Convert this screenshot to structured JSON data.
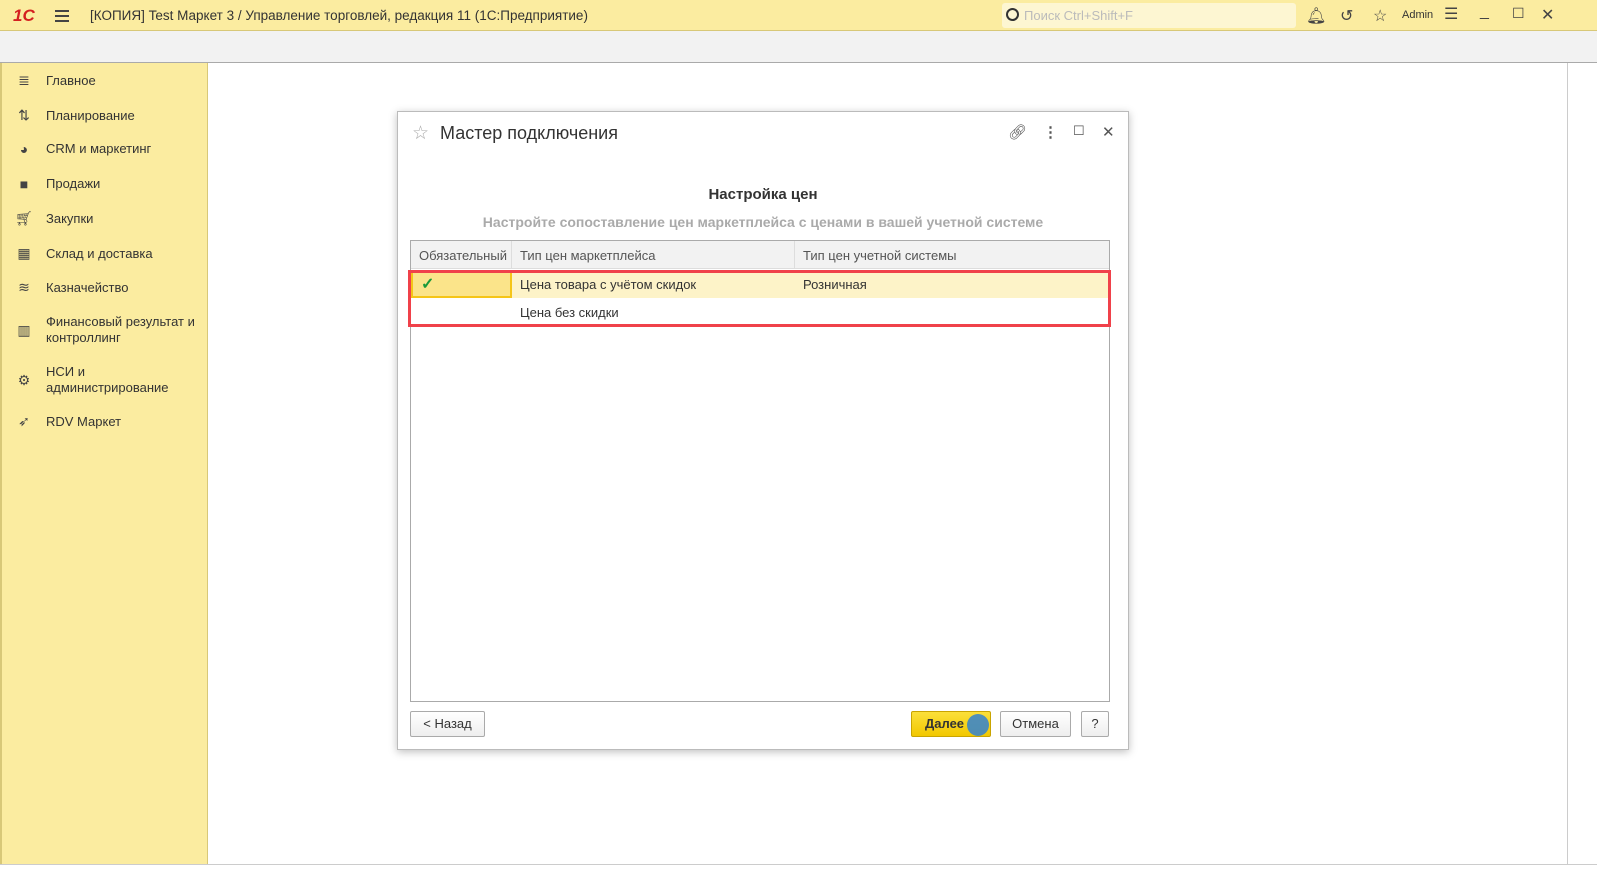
{
  "app": {
    "logo": "1С",
    "title": "[КОПИЯ] Test Маркет 3 / Управление торговлей, редакция 11  (1С:Предприятие)",
    "search_placeholder": "Поиск Ctrl+Shift+F",
    "user": "Admin"
  },
  "sidebar": {
    "items": [
      {
        "label": "Главное",
        "icon": "list-icon"
      },
      {
        "label": "Планирование",
        "icon": "planning-icon"
      },
      {
        "label": "CRM и маркетинг",
        "icon": "pie-chart-icon"
      },
      {
        "label": "Продажи",
        "icon": "bag-icon"
      },
      {
        "label": "Закупки",
        "icon": "cart-icon"
      },
      {
        "label": "Склад и доставка",
        "icon": "warehouse-icon"
      },
      {
        "label": "Казначейство",
        "icon": "coins-icon"
      },
      {
        "label": "Финансовый результат и контроллинг",
        "icon": "bar-chart-icon"
      },
      {
        "label": "НСИ и администрирование",
        "icon": "gear-icon"
      },
      {
        "label": "RDV Маркет",
        "icon": "rocket-icon"
      }
    ]
  },
  "dialog": {
    "title": "Мастер подключения",
    "heading": "Настройка цен",
    "subheading": "Настройте сопоставление цен маркетплейса с ценами в вашей учетной системе",
    "columns": [
      "Обязательный",
      "Тип цен маркетплейса",
      "Тип цен учетной системы"
    ],
    "rows": [
      {
        "required": "✓",
        "marketplace": "Цена товара с учётом скидок",
        "system": "Розничная"
      },
      {
        "required": "",
        "marketplace": "Цена без скидки",
        "system": ""
      }
    ],
    "buttons": {
      "back": "< Назад",
      "next": "Далее",
      "cancel": "Отмена",
      "help": "?"
    }
  }
}
